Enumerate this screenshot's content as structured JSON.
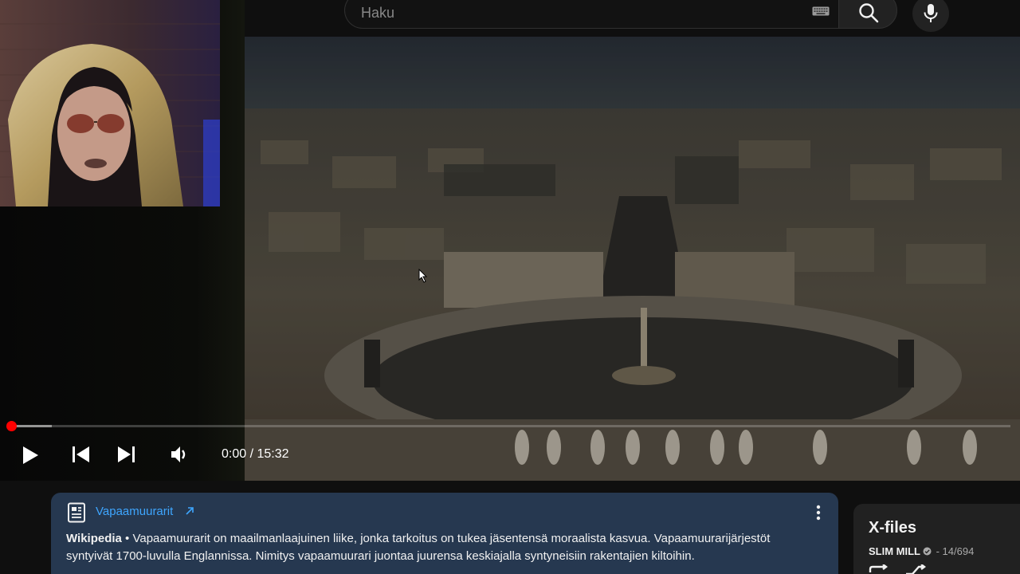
{
  "search": {
    "placeholder": "Haku",
    "value": ""
  },
  "player": {
    "current_time": "0:00",
    "separator": " / ",
    "duration": "15:32",
    "played_fraction": 0.0,
    "buffered_fraction": 0.04
  },
  "info_card": {
    "link_label": "Vapaamuurarit",
    "source": "Wikipedia",
    "bullet": " • ",
    "text": "Vapaamuurarit on maailmanlaajuinen liike, jonka tarkoitus on tukea jäsentensä moraalista kasvua. Vapaamuurarijärjestöt syntyivät 1700-luvulla Englannissa. Nimitys vapaamuurari juontaa juurensa keskiajalla syntyneisiin rakentajien kiltoihin."
  },
  "playlist": {
    "title": "X-files",
    "channel": "SLIM MILL",
    "position": " - 14/694"
  },
  "colors": {
    "accent_red": "#ff0000",
    "link_blue": "#3ea6ff",
    "card_background": "#263850"
  }
}
